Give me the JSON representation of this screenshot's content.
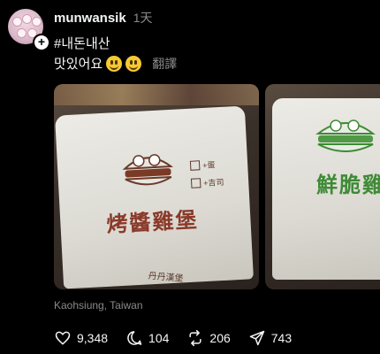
{
  "post": {
    "username": "munwansik",
    "time": "1天",
    "hashtag": "#내돈내산",
    "caption": "맛있어요",
    "emojis": [
      "smiling-face-icon",
      "grinning-face-icon"
    ],
    "translate_label": "翻譯",
    "location": "Kaohsiung, Taiwan"
  },
  "photo1": {
    "checkbox1": "+蛋",
    "checkbox2": "+吉司",
    "title": "烤醬雞堡",
    "brand": "丹丹漢堡"
  },
  "photo2": {
    "title": "鮮脆雞"
  },
  "actions": {
    "likes": "9,348",
    "comments": "104",
    "reposts": "206",
    "shares": "743"
  },
  "colors": {
    "background": "#000000",
    "text": "#f3f5f7",
    "muted": "#8a8a8a",
    "bag_title_red": "#8a3a2a",
    "bag_title_green": "#3e8a35"
  }
}
